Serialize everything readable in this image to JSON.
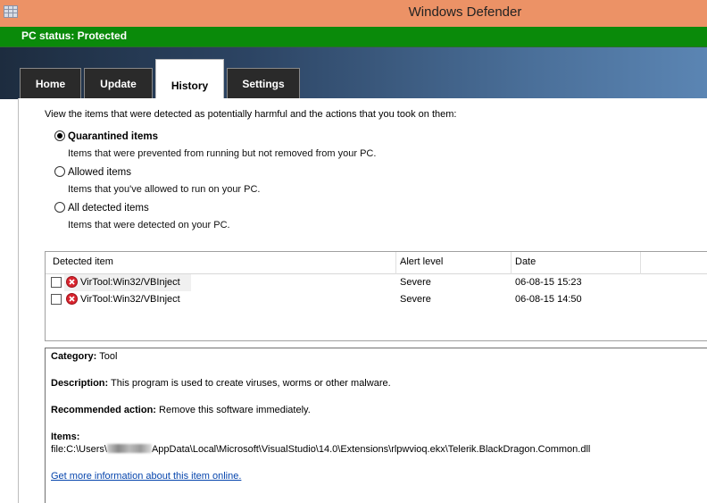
{
  "window": {
    "title": "Windows Defender",
    "icon": "defender-app-icon"
  },
  "status": {
    "text": "PC status: Protected",
    "color": "#0a8a0a"
  },
  "tabs": [
    {
      "label": "Home",
      "active": false
    },
    {
      "label": "Update",
      "active": false
    },
    {
      "label": "History",
      "active": true
    },
    {
      "label": "Settings",
      "active": false
    }
  ],
  "history": {
    "intro": "View the items that were detected as potentially harmful and the actions that you took on them:",
    "options": [
      {
        "label": "Quarantined items",
        "description": "Items that were prevented from running but not removed from your PC.",
        "selected": true
      },
      {
        "label": "Allowed items",
        "description": "Items that you've allowed to run on your PC.",
        "selected": false
      },
      {
        "label": "All detected items",
        "description": "Items that were detected on your PC.",
        "selected": false
      }
    ],
    "table": {
      "columns": [
        "Detected item",
        "Alert level",
        "Date"
      ],
      "rows": [
        {
          "name": "VirTool:Win32/VBInject",
          "alert": "Severe",
          "date": "06-08-15 15:23",
          "icon": "threat-severe-icon"
        },
        {
          "name": "VirTool:Win32/VBInject",
          "alert": "Severe",
          "date": "06-08-15 14:50",
          "icon": "threat-severe-icon"
        }
      ]
    },
    "details": {
      "category_label": "Category:",
      "category_value": "Tool",
      "description_label": "Description:",
      "description_value": "This program is used to create viruses, worms or other malware.",
      "action_label": "Recommended action:",
      "action_value": "Remove this software immediately.",
      "items_label": "Items:",
      "path_prefix": "file:C:\\Users\\",
      "path_suffix": "AppData\\Local\\Microsoft\\VisualStudio\\14.0\\Extensions\\rlpwvioq.ekx\\Telerik.BlackDragon.Common.dll",
      "more_info_link": "Get more information about this item online."
    }
  }
}
